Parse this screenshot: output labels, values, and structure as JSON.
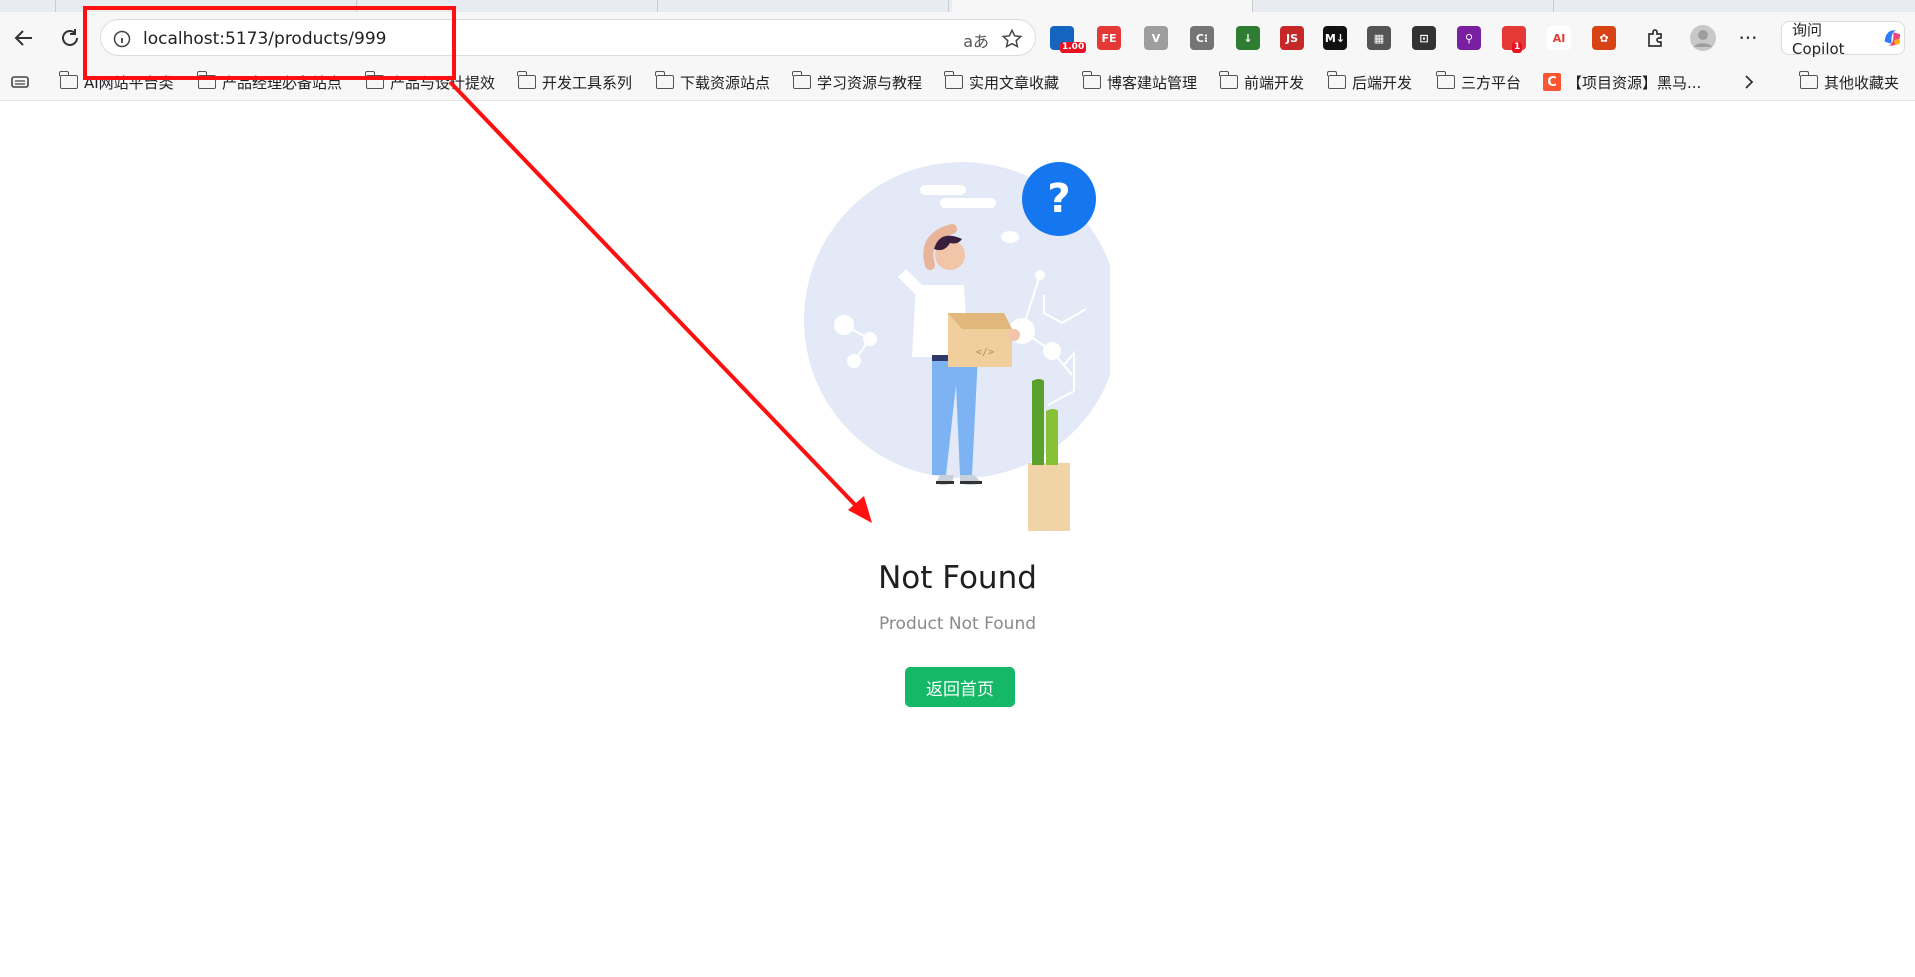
{
  "browser": {
    "url": "localhost:5173/products/999",
    "translate_glyph": "aあ",
    "extensions": [
      {
        "icon": "video-speed-icon",
        "label": "",
        "badge": "1.00",
        "color": "#1565c0"
      },
      {
        "icon": "fe-helper-icon",
        "label": "FE",
        "color": "#e53935"
      },
      {
        "icon": "vue-devtools-icon",
        "label": "V",
        "color": "#9e9e9e"
      },
      {
        "icon": "css-peeper-icon",
        "label": "C⁝",
        "color": "#757575"
      },
      {
        "icon": "download-icon",
        "label": "↓",
        "color": "#2e7d32"
      },
      {
        "icon": "js-icon",
        "label": "JS",
        "color": "#c62828"
      },
      {
        "icon": "markdown-icon",
        "label": "M↓",
        "color": "#111111"
      },
      {
        "icon": "qr-code-icon",
        "label": "▦",
        "color": "#555555"
      },
      {
        "icon": "robot-icon",
        "label": "⊡",
        "color": "#333333"
      },
      {
        "icon": "ai-search-icon",
        "label": "⚲",
        "color": "#7b1fa2"
      },
      {
        "icon": "red-ext-icon",
        "label": "",
        "badge": "1",
        "color": "#e53935"
      },
      {
        "icon": "ai-icon",
        "label": "AI",
        "color": "#ffffff"
      },
      {
        "icon": "bug-icon",
        "label": "✿",
        "color": "#d84315"
      }
    ],
    "copilot_label": "询问 Copilot"
  },
  "bookmarks": [
    "AI网站平台类",
    "产品经理必备站点",
    "产品与设计提效",
    "开发工具系列",
    "下载资源站点",
    "学习资源与教程",
    "实用文章收藏",
    "博客建站管理",
    "前端开发",
    "后端开发",
    "三方平台",
    "【项目资源】黑马...",
    "其他收藏夹"
  ],
  "page": {
    "title": "Not Found",
    "subtitle": "Product Not Found",
    "button": "返回首页",
    "accent": "#14b866",
    "question_mark": "?"
  },
  "annotation": {
    "color": "#ff1010"
  }
}
